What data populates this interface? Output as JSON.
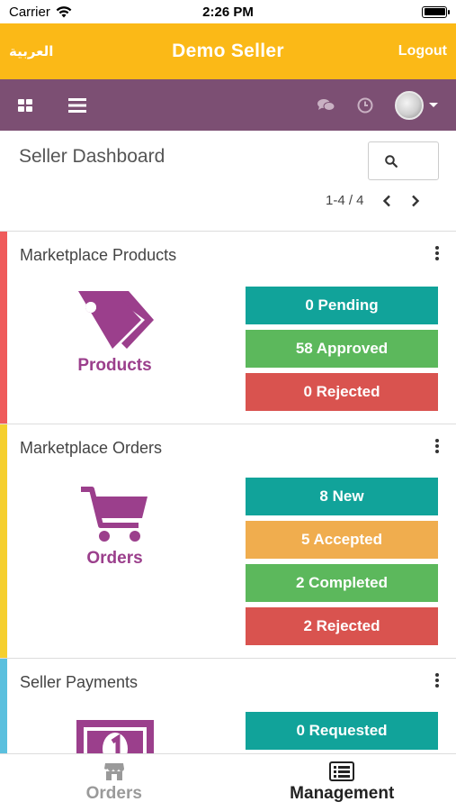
{
  "status_bar": {
    "carrier": "Carrier",
    "time": "2:26 PM"
  },
  "header": {
    "language": "العربية",
    "title": "Demo Seller",
    "logout": "Logout",
    "color": "#fbb917"
  },
  "toolbar": {
    "color": "#7c4f73",
    "icons": [
      "grid-icon",
      "menu-icon",
      "chat-icon",
      "clock-icon",
      "avatar"
    ]
  },
  "dashboard": {
    "title": "Seller Dashboard",
    "pager": "1-4 / 4"
  },
  "cards": [
    {
      "title": "Marketplace Products",
      "stripe_color": "#ef5b5b",
      "icon": "tag-icon",
      "label": "Products",
      "buttons": [
        {
          "label": "0 Pending",
          "color": "#11a39a"
        },
        {
          "label": "58 Approved",
          "color": "#5cb85c"
        },
        {
          "label": "0 Rejected",
          "color": "#d9534f"
        }
      ]
    },
    {
      "title": "Marketplace Orders",
      "stripe_color": "#f5cf2e",
      "icon": "cart-icon",
      "label": "Orders",
      "buttons": [
        {
          "label": "8 New",
          "color": "#11a39a"
        },
        {
          "label": "5 Accepted",
          "color": "#f0ad4e"
        },
        {
          "label": "2 Completed",
          "color": "#5cb85c"
        },
        {
          "label": "2 Rejected",
          "color": "#d9534f"
        }
      ]
    },
    {
      "title": "Seller Payments",
      "stripe_color": "#5bc0de",
      "icon": "money-icon",
      "label": "",
      "buttons": [
        {
          "label": "0 Requested",
          "color": "#11a39a"
        }
      ]
    }
  ],
  "tabbar": {
    "tabs": [
      {
        "label": "Orders",
        "icon": "store-icon",
        "active": false
      },
      {
        "label": "Management",
        "icon": "list-icon",
        "active": true
      }
    ]
  },
  "accent": "#9b3f8c"
}
